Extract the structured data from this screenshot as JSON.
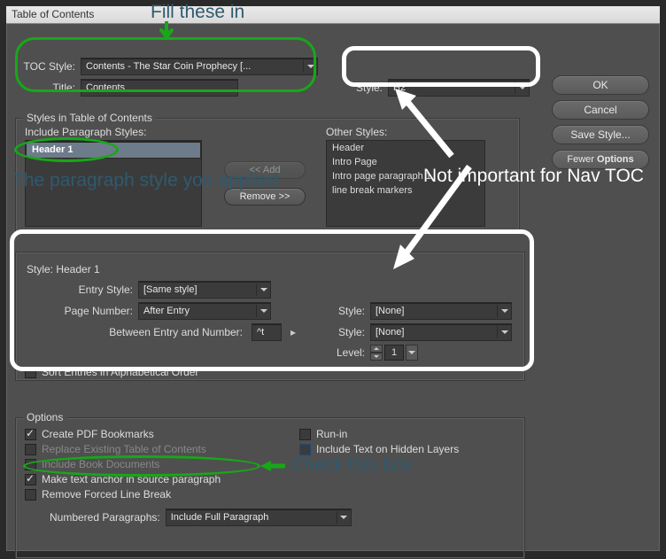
{
  "window": {
    "title": "Table of Contents"
  },
  "buttons": {
    "ok": "OK",
    "cancel": "Cancel",
    "save_style": "Save Style...",
    "fewer_options": "Fewer Options",
    "add": "<< Add",
    "remove": "Remove >>"
  },
  "top": {
    "toc_style_label": "TOC Style:",
    "toc_style_value": "Contents - The Star Coin Prophecy [...",
    "title_label": "Title:",
    "title_value": "Contents",
    "style_label": "Style:",
    "style_value": "H2"
  },
  "styles_group": {
    "title": "Styles in Table of Contents",
    "include_label": "Include Paragraph Styles:",
    "include_items": [
      "Header 1"
    ],
    "other_label": "Other Styles:",
    "other_items": [
      "Header",
      "Intro Page",
      "Intro page paragraph 1",
      "line break markers"
    ]
  },
  "detail": {
    "style_label": "Style: Header 1",
    "entry_style_label": "Entry Style:",
    "entry_style_value": "[Same style]",
    "page_number_label": "Page Number:",
    "page_number_value": "After Entry",
    "between_label": "Between Entry and Number:",
    "between_value": "^t",
    "sort_label": "Sort Entries in Alphabetical Order",
    "right_style1_label": "Style:",
    "right_style1_value": "[None]",
    "right_style2_label": "Style:",
    "right_style2_value": "[None]",
    "level_label": "Level:",
    "level_value": "1"
  },
  "options": {
    "title": "Options",
    "create_pdf": "Create PDF Bookmarks",
    "replace_toc": "Replace Existing Table of Contents",
    "include_book": "Include Book Documents",
    "anchor": "Make text anchor in source paragraph",
    "remove_break": "Remove Forced Line Break",
    "runin": "Run-in",
    "hidden_layers": "Include Text on Hidden Layers",
    "numbered_label": "Numbered Paragraphs:",
    "numbered_value": "Include Full Paragraph"
  },
  "annotations": {
    "fill": "Fill these in",
    "para": "The paragraph style you applied",
    "not_imp": "Not important for Nav TOC",
    "check": "Check this box"
  }
}
